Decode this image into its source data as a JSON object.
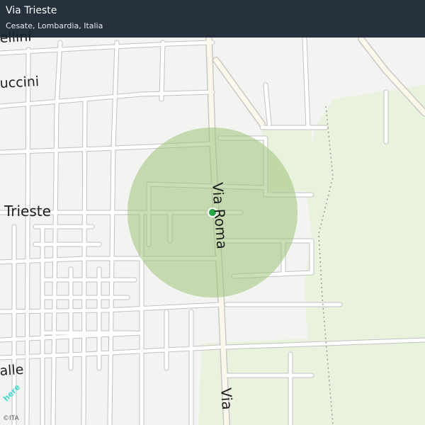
{
  "header": {
    "title": "Via Trieste",
    "subtitle": "Cesate, Lombardia, Italia"
  },
  "labels": {
    "via_roma": "Via Roma",
    "via_roma_bottom": "Via",
    "trieste": "Trieste",
    "puccini": "uccini",
    "bellini": "ellini",
    "bottom_left": "alle"
  },
  "branding": {
    "logo": "here",
    "attribution": "©ITA"
  },
  "colors": {
    "radius_fill": "#9dc27a",
    "location_dot": "#28a745",
    "header_bg": "#16212e",
    "green_area": "#e6f2da"
  }
}
